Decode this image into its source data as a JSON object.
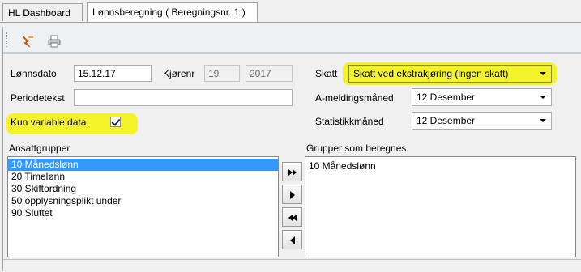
{
  "tabs": [
    {
      "label": "HL Dashboard"
    },
    {
      "label": "Lønnsberegning ( Beregningsnr. 1 )"
    }
  ],
  "form": {
    "lonnsdato_label": "Lønnsdato",
    "lonnsdato_value": "15.12.17",
    "kjorenr_label": "Kjørenr",
    "kjorenr_value": "19",
    "year_value": "2017",
    "periodetekst_label": "Periodetekst",
    "periodetekst_value": "",
    "kun_variable_label": "Kun variable data",
    "kun_variable_checked": true,
    "skatt_label": "Skatt",
    "skatt_value": "Skatt ved ekstrakjøring (ingen skatt)",
    "ameldingsmaned_label": "A-meldingsmåned",
    "ameldingsmaned_value": "12 Desember",
    "statistikkmaned_label": "Statistikkmåned",
    "statistikkmaned_value": "12 Desember"
  },
  "ansattgrupper": {
    "label": "Ansattgrupper",
    "items": [
      {
        "text": "10  Månedslønn",
        "selected": true
      },
      {
        "text": "20  Timelønn",
        "selected": false
      },
      {
        "text": "30  Skiftordning",
        "selected": false
      },
      {
        "text": "50  opplysningsplikt under",
        "selected": false
      },
      {
        "text": "90  Sluttet",
        "selected": false
      }
    ]
  },
  "grupper_som_beregnes": {
    "label": "Grupper som beregnes",
    "items": [
      {
        "text": "10  Månedslønn"
      }
    ]
  },
  "colors": {
    "highlight": "#f4f32a",
    "selection": "#3399ff"
  }
}
